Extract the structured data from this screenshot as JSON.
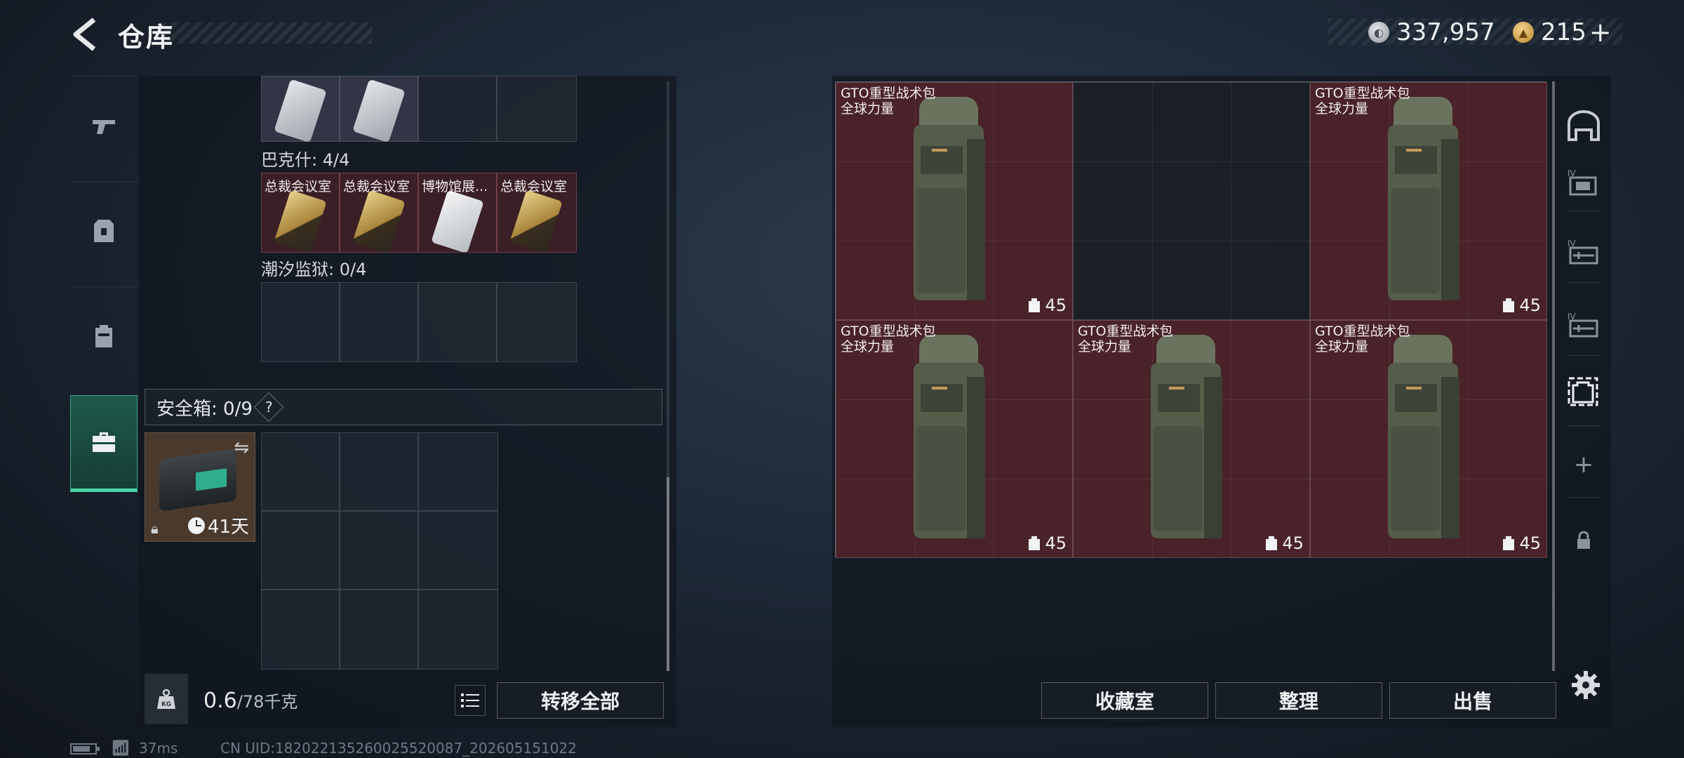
{
  "header": {
    "title": "仓库",
    "currency_silver": "337,957",
    "currency_gold": "215",
    "currency_gold_plus": "+"
  },
  "left": {
    "sections": [
      {
        "label": "巴克什: 4/4",
        "cards": [
          "总裁会议室",
          "总裁会议室",
          "博物馆展...",
          "总裁会议室"
        ]
      },
      {
        "label": "潮汐监狱: 0/4"
      }
    ],
    "safebox": {
      "label": "安全箱: 0/9",
      "help": "?",
      "days": "41天"
    },
    "weight": {
      "current": "0.6",
      "max": "/78千克"
    },
    "transfer_all": "转移全部"
  },
  "stash": {
    "items": [
      {
        "name_line1": "GTO重型战术包",
        "name_line2": "全球力量",
        "capacity": "45"
      },
      {
        "name_line1": "GTO重型战术包",
        "name_line2": "全球力量",
        "capacity": "45"
      },
      {
        "name_line1": "GTO重型战术包",
        "name_line2": "全球力量",
        "capacity": "45"
      },
      {
        "name_line1": "GTO重型战术包",
        "name_line2": "全球力量",
        "capacity": "45"
      },
      {
        "name_line1": "GTO重型战术包",
        "name_line2": "全球力量",
        "capacity": "45"
      }
    ],
    "buttons": {
      "collection": "收藏室",
      "organize": "整理",
      "sell": "出售"
    }
  },
  "rail": {
    "add": "+"
  },
  "status": {
    "ping": "37ms",
    "uid": "CN UID:1820221352600255200​87_202605151022"
  },
  "colors": {
    "accent_green": "#4cd3a6",
    "item_red": "#4a2229",
    "card_red": "#3a1f26"
  }
}
